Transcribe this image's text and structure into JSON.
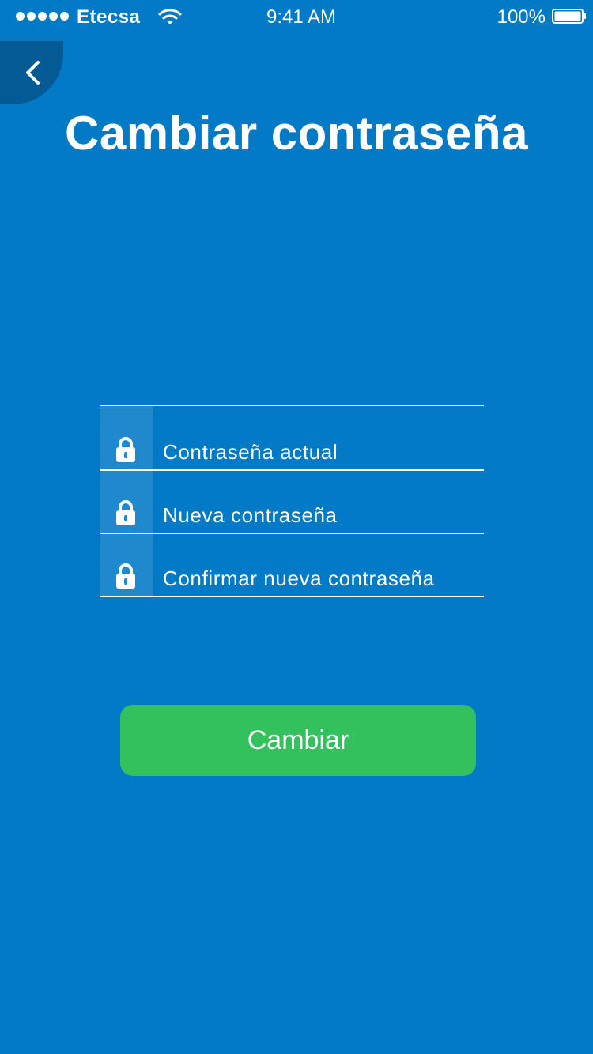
{
  "status_bar": {
    "carrier": "Etecsa",
    "time": "9:41 AM",
    "battery": "100%",
    "signal_bars": 5,
    "wifi_icon": "wifi-icon",
    "battery_icon": "battery-icon"
  },
  "nav": {
    "back_icon": "chevron-left-icon"
  },
  "page": {
    "title": "Cambiar contraseña"
  },
  "form": {
    "fields": [
      {
        "icon": "lock-icon",
        "placeholder": "Contraseña actual"
      },
      {
        "icon": "lock-icon",
        "placeholder": "Nueva contraseña"
      },
      {
        "icon": "lock-icon",
        "placeholder": "Confirmar nueva contraseña"
      }
    ],
    "submit_label": "Cambiar"
  },
  "colors": {
    "background": "#027AC6",
    "back_button": "#035A94",
    "icon_box": "#1E89CD",
    "primary_button": "#33C15E",
    "text": "#FFFFFF"
  }
}
